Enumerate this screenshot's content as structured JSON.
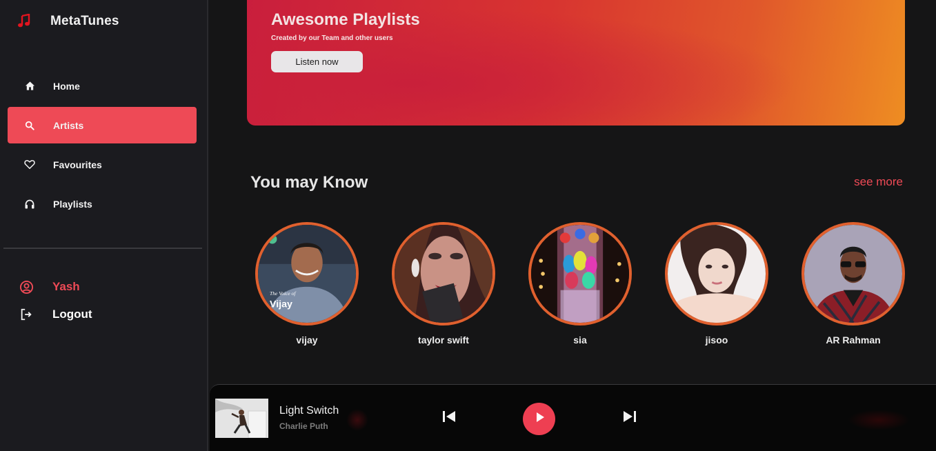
{
  "app": {
    "name": "MetaTunes"
  },
  "sidebar": {
    "items": [
      {
        "label": "Home",
        "icon": "home-icon",
        "active": false
      },
      {
        "label": "Artists",
        "icon": "search-icon",
        "active": true
      },
      {
        "label": "Favourites",
        "icon": "heart-icon",
        "active": false
      },
      {
        "label": "Playlists",
        "icon": "headphones-icon",
        "active": false
      }
    ],
    "user": {
      "name": "Yash",
      "icon": "user-circle-icon"
    },
    "logout": {
      "label": "Logout",
      "icon": "logout-icon"
    }
  },
  "banner": {
    "title": "Awesome Playlists",
    "subtitle": "Created by our Team and other users",
    "button_label": "Listen now"
  },
  "artists_section": {
    "title": "You may Know",
    "see_more_label": "see more",
    "artists": [
      {
        "name": "vijay",
        "cover_text_1": "The Voice of",
        "cover_text_2": "Vijay"
      },
      {
        "name": "taylor swift"
      },
      {
        "name": "sia"
      },
      {
        "name": "jisoo"
      },
      {
        "name": "AR Rahman"
      }
    ]
  },
  "player": {
    "track_title": "Light Switch",
    "track_artist": "Charlie Puth"
  },
  "colors": {
    "accent": "#ee4a56",
    "sidebar_bg": "#1b1b1f",
    "main_bg": "#151516",
    "avatar_ring": "#e0602e"
  }
}
